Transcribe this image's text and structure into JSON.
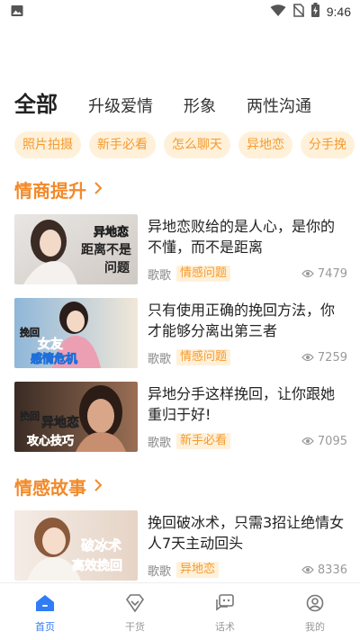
{
  "status_bar": {
    "time": "9:46"
  },
  "category_tabs": [
    {
      "label": "全部",
      "active": true
    },
    {
      "label": "升级爱情",
      "active": false
    },
    {
      "label": "形象",
      "active": false
    },
    {
      "label": "两性沟通",
      "active": false
    }
  ],
  "chips": [
    "照片拍摄",
    "新手必看",
    "怎么聊天",
    "异地恋",
    "分手挽"
  ],
  "sections": [
    {
      "title": "情商提升",
      "articles": [
        {
          "title": "异地恋败给的是人心，是你的不懂，而不是距离",
          "author": "歌歌",
          "tag": "情感问题",
          "views": "7479",
          "thumb_text": [
            "异地恋",
            "距离不是",
            "问题"
          ]
        },
        {
          "title": "只有使用正确的挽回方法，你才能够分离出第三者",
          "author": "歌歌",
          "tag": "情感问题",
          "views": "7259",
          "thumb_text": [
            "挽回",
            "女友",
            "感情危机"
          ]
        },
        {
          "title": "异地分手这样挽回，让你跟她重归于好!",
          "author": "歌歌",
          "tag": "新手必看",
          "views": "7095",
          "thumb_text": [
            "挽回",
            "异地恋",
            "攻心技巧"
          ]
        }
      ]
    },
    {
      "title": "情感故事",
      "articles": [
        {
          "title": "挽回破冰术，只需3招让绝情女人7天主动回头",
          "author": "歌歌",
          "tag": "异地恋",
          "views": "8336",
          "thumb_text": [
            "破冰术",
            "高效挽回"
          ]
        }
      ]
    }
  ],
  "bottom_nav": [
    {
      "label": "首页",
      "icon": "home-icon",
      "active": true
    },
    {
      "label": "干货",
      "icon": "diamond-icon",
      "active": false
    },
    {
      "label": "话术",
      "icon": "chat-icon",
      "active": false
    },
    {
      "label": "我的",
      "icon": "profile-icon",
      "active": false
    }
  ],
  "colors": {
    "accent": "#f28a2a",
    "chip_bg": "#fff1d9",
    "chip_text": "#f59a2e",
    "nav_active": "#2f7cf6"
  }
}
